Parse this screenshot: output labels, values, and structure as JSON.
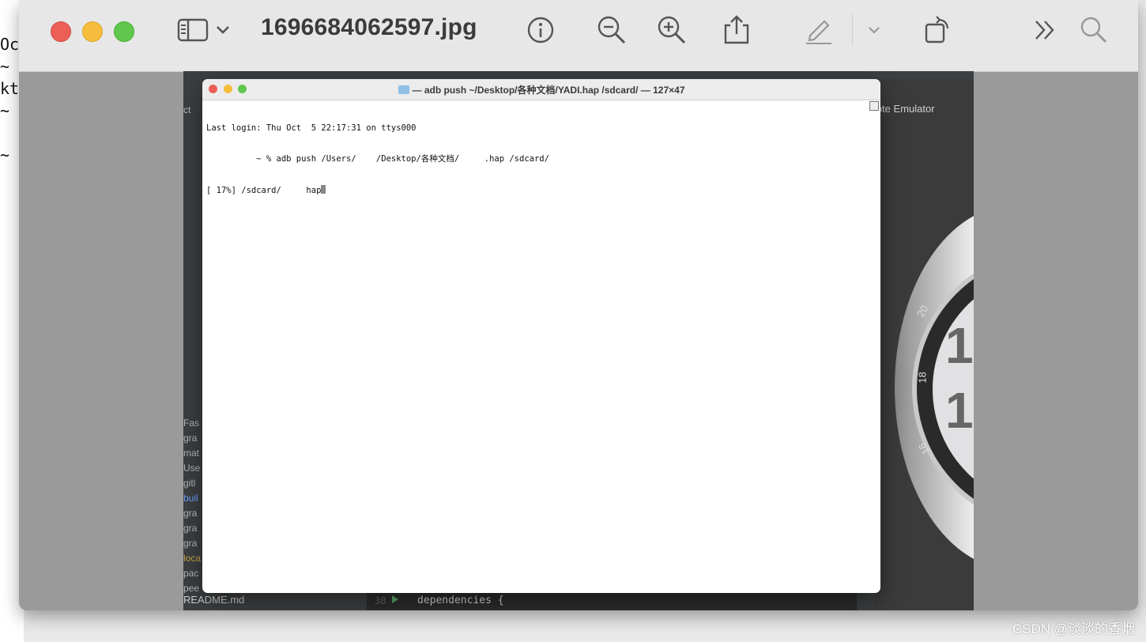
{
  "background_terminal": {
    "lines": [
      "Oc",
      "~",
      "kt",
      "~",
      "",
      "~"
    ]
  },
  "toolbar": {
    "title": "1696684062597.jpg",
    "icons": [
      "sidebar-toggle-icon",
      "chevron-down-icon",
      "info-icon",
      "zoom-out-icon",
      "zoom-in-icon",
      "share-icon",
      "markup-pen-icon",
      "chevron-down-icon",
      "rotate-icon",
      "more-icon",
      "search-icon"
    ]
  },
  "ide": {
    "emulator_label": "mote Emulator",
    "readme_file": "README.md",
    "left_snippets": [
      "ct",
      "Fas",
      "gra",
      "mat",
      "Use",
      "gitl",
      "buil",
      "gra",
      "gra",
      "gra",
      "loca",
      "pac",
      "pee"
    ],
    "code_line_number": "38",
    "code_text": "dependencies {"
  },
  "terminal": {
    "title": "— adb push ~/Desktop/各种文档/YADI.hap /sdcard/ — 127×47",
    "lines": [
      "Last login: Thu Oct  5 22:17:31 on ttys000",
      "          ~ % adb push /Users/    /Desktop/各种文档/     .hap /sdcard/",
      "[ 17%] /sdcard/     hap"
    ]
  },
  "watch": {
    "numbers": [
      "1",
      "1"
    ],
    "bezel_labels": [
      "20",
      "18",
      "16"
    ]
  },
  "watermark": "CSDN @淡淡的香烟",
  "colors": {
    "close": "#ec5f57",
    "minimize": "#f5bd3b",
    "zoom": "#5fc74b"
  }
}
